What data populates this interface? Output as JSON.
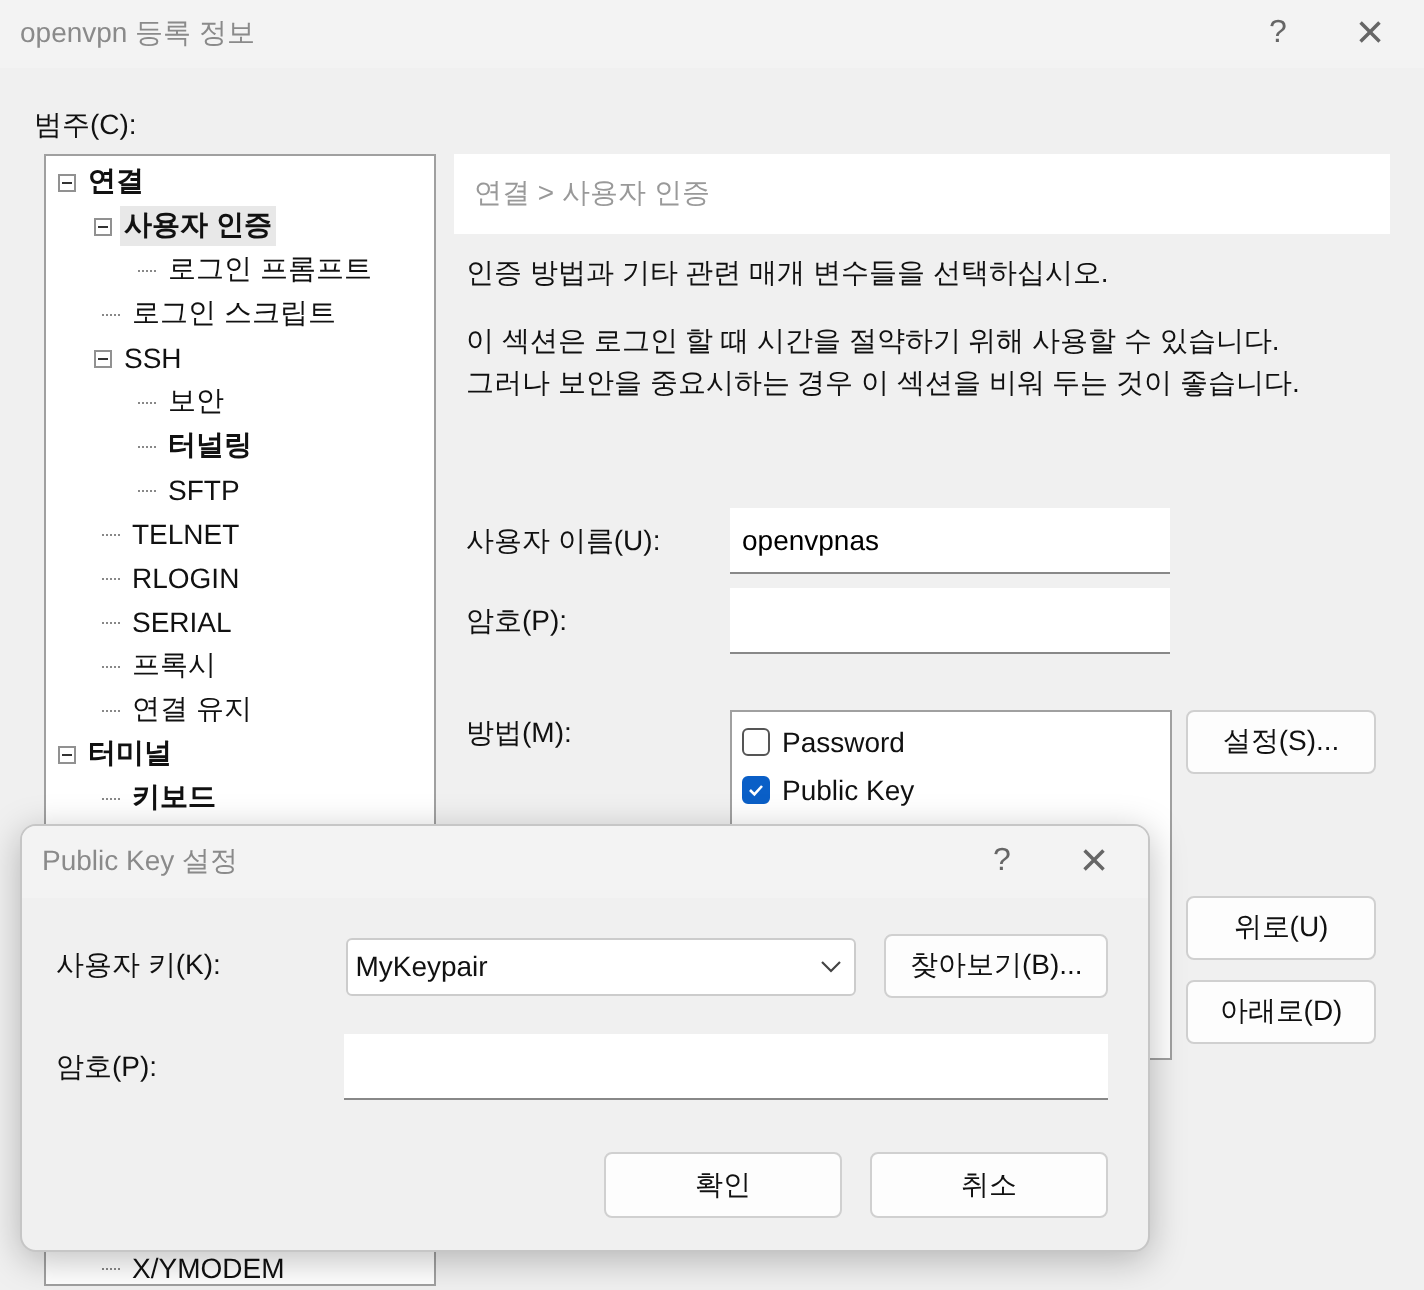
{
  "window": {
    "title": "openvpn 등록 정보",
    "help": "?",
    "close": "×"
  },
  "category_label": "범주(C):",
  "tree": [
    {
      "label": "연결",
      "bold": true,
      "selected": false,
      "expanded": true,
      "children": [
        {
          "label": "사용자 인증",
          "bold": true,
          "selected": true,
          "expanded": true,
          "children": [
            {
              "label": "로그인 프롬프트",
              "bold": false,
              "selected": false
            }
          ]
        },
        {
          "label": "로그인 스크립트",
          "bold": false,
          "selected": false
        },
        {
          "label": "SSH",
          "bold": false,
          "selected": false,
          "expanded": true,
          "children": [
            {
              "label": "보안",
              "bold": false,
              "selected": false
            },
            {
              "label": "터널링",
              "bold": true,
              "selected": false
            },
            {
              "label": "SFTP",
              "bold": false,
              "selected": false
            }
          ]
        },
        {
          "label": "TELNET",
          "bold": false,
          "selected": false
        },
        {
          "label": "RLOGIN",
          "bold": false,
          "selected": false
        },
        {
          "label": "SERIAL",
          "bold": false,
          "selected": false
        },
        {
          "label": "프록시",
          "bold": false,
          "selected": false
        },
        {
          "label": "연결 유지",
          "bold": false,
          "selected": false
        }
      ]
    },
    {
      "label": "터미널",
      "bold": true,
      "selected": false,
      "expanded": true,
      "children": [
        {
          "label": "키보드",
          "bold": true,
          "selected": false
        }
      ]
    }
  ],
  "tree_tail": [
    {
      "label": "X/YMODEM",
      "bold": false,
      "selected": false
    }
  ],
  "breadcrumb": "연결 > 사용자 인증",
  "description": "인증 방법과 기타 관련 매개 변수들을 선택하십시오.",
  "note_lines": [
    "이 섹션은 로그인 할 때 시간을 절약하기 위해 사용할 수 있습니다.",
    "그러나 보안을 중요시하는 경우 이 섹션을 비워 두는 것이 좋습니다."
  ],
  "username": {
    "label": "사용자 이름(U):",
    "value": "openvpnas"
  },
  "password": {
    "label": "암호(P):"
  },
  "method": {
    "label": "방법(M):",
    "items": [
      {
        "label": "Password",
        "checked": false
      },
      {
        "label": "Public Key",
        "checked": true
      }
    ]
  },
  "buttons": {
    "settings": "설정(S)...",
    "up": "위로(U)",
    "down": "아래로(D)"
  },
  "dialog": {
    "title": "Public Key 설정",
    "help": "?",
    "close": "×",
    "user_key": {
      "label": "사용자 키(K):",
      "value": "MyKeypair"
    },
    "browse": "찾아보기(B)...",
    "password": {
      "label": "암호(P):"
    },
    "ok": "확인",
    "cancel": "취소"
  }
}
